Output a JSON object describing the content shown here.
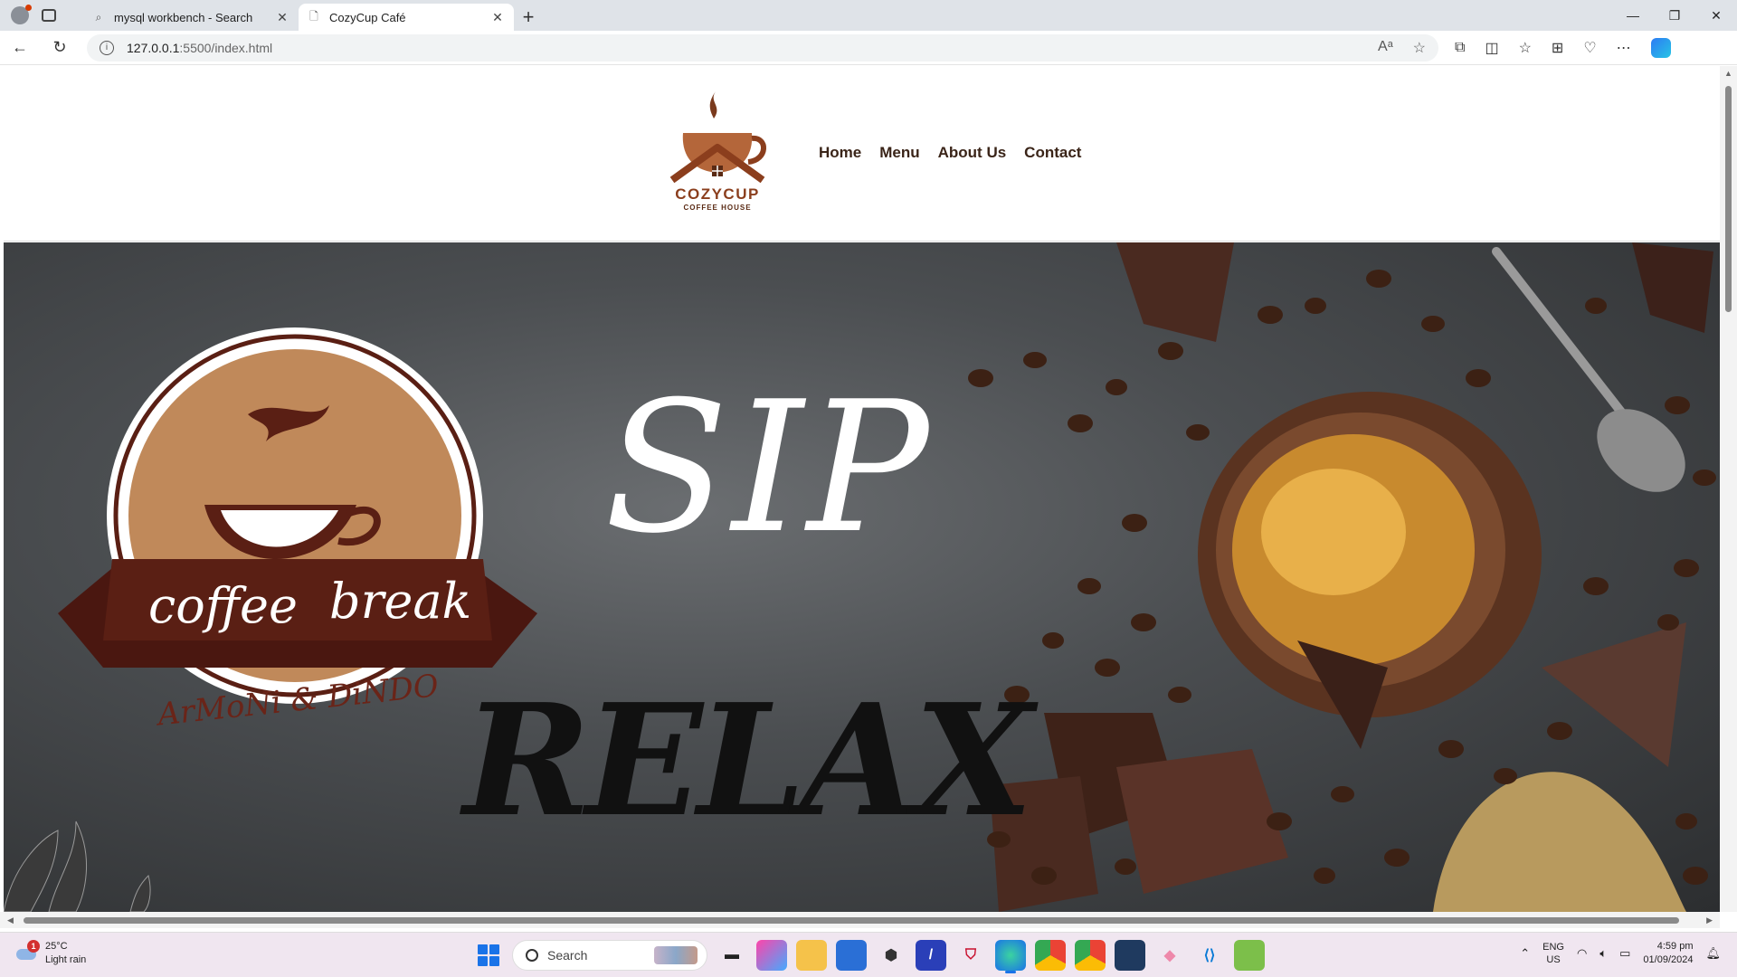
{
  "browser": {
    "tabs": [
      {
        "title": "mysql workbench - Search",
        "active": false
      },
      {
        "title": "CozyCup Café",
        "active": true
      }
    ],
    "address": {
      "host": "127.0.0.1",
      "path": ":5500/index.html"
    }
  },
  "site": {
    "logo": {
      "name": "COZYCUP",
      "tagline": "COFFEE HOUSE"
    },
    "nav": [
      "Home",
      "Menu",
      "About Us",
      "Contact"
    ],
    "hero": {
      "headline_top": "SIP",
      "headline_bottom": "RELAX",
      "badge": {
        "ribbon_left": "coffee",
        "ribbon_right": "break",
        "signature": "ArMoNi & DiNDO"
      }
    }
  },
  "taskbar": {
    "weather": {
      "temp": "25°C",
      "condition": "Light rain",
      "alert_count": "1"
    },
    "search_placeholder": "Search",
    "language": {
      "line1": "ENG",
      "line2": "US"
    },
    "clock": {
      "time": "4:59 pm",
      "date": "01/09/2024"
    }
  },
  "colors": {
    "brand_brown": "#8b3e1d",
    "nav_text": "#3a2418",
    "accent_blue": "#1a73e8"
  }
}
